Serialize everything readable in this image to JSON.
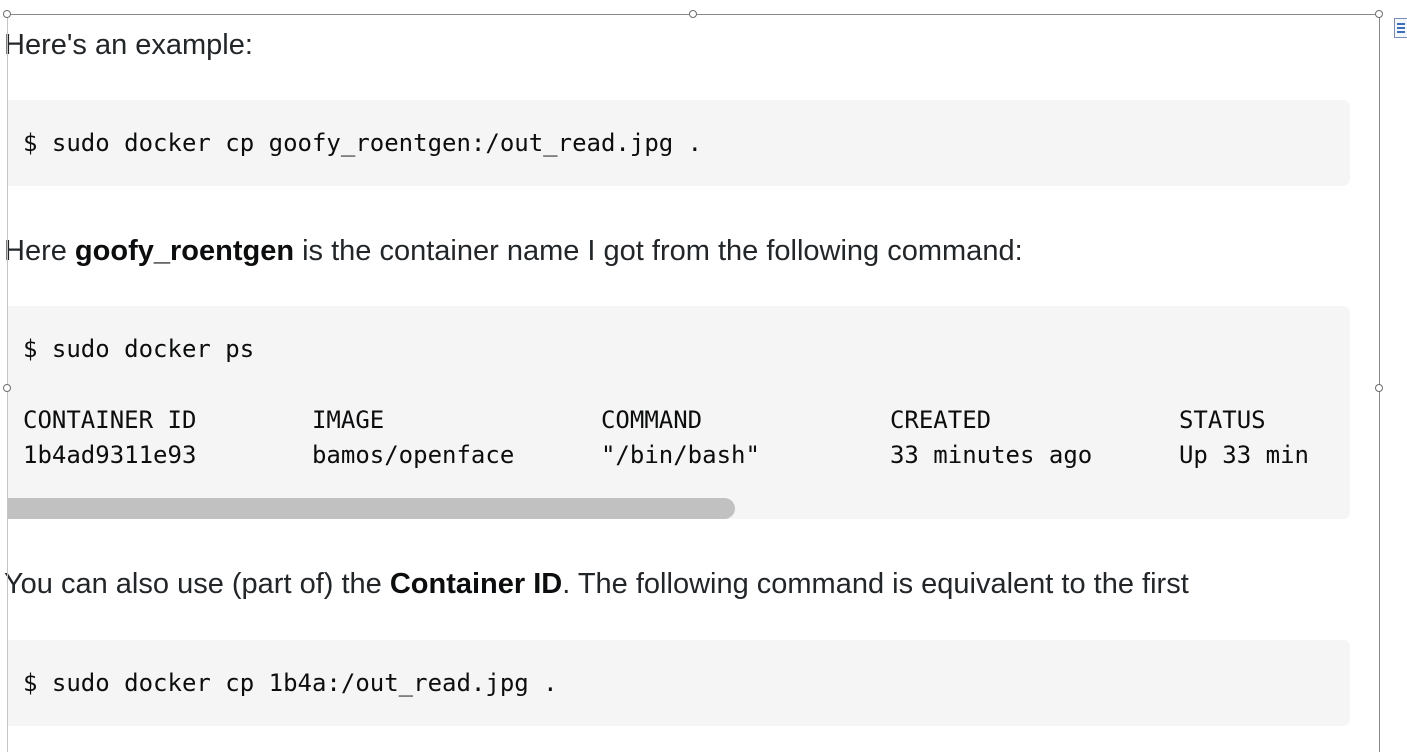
{
  "paragraphs": {
    "intro": "Here's an example:",
    "container_name_prefix": "Here ",
    "container_name": "goofy_roentgen",
    "container_name_suffix": " is the container name I got from the following command:",
    "alt_prefix": "You can also use (part of) the ",
    "alt_bold": "Container ID",
    "alt_suffix": ". The following command is equivalent to the first"
  },
  "code_blocks": {
    "cp_by_name": "$ sudo docker cp goofy_roentgen:/out_read.jpg .",
    "ps_command": "$ sudo docker ps",
    "ps_header": "CONTAINER ID        IMAGE               COMMAND             CREATED             STATUS",
    "ps_row": "1b4ad9311e93        bamos/openface      \"/bin/bash\"         33 minutes ago      Up 33 min",
    "cp_by_id": "$ sudo docker cp 1b4a:/out_read.jpg ."
  },
  "icons": {
    "layout_options": "layout-options-icon"
  }
}
